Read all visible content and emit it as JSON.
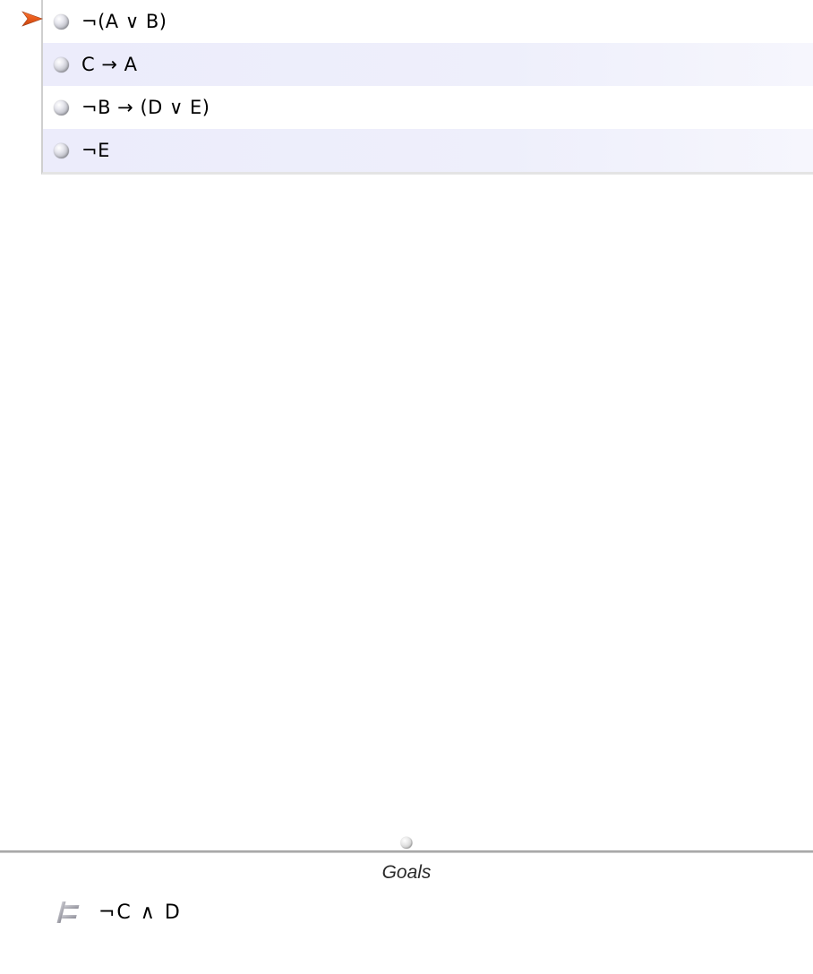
{
  "premises": [
    {
      "formula": "¬(A ∨ B)"
    },
    {
      "formula": "C → A"
    },
    {
      "formula": "¬B → (D ∨ E)"
    },
    {
      "formula": "¬E"
    }
  ],
  "goals": {
    "title": "Goals",
    "items": [
      {
        "formula": "¬C  ∧  D"
      }
    ]
  }
}
